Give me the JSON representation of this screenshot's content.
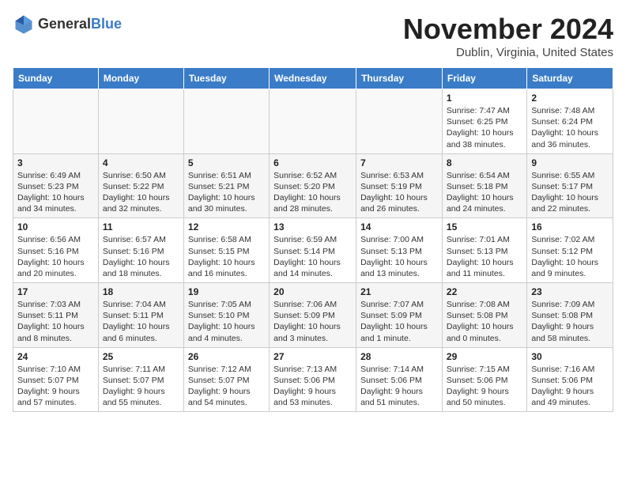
{
  "header": {
    "logo_general": "General",
    "logo_blue": "Blue",
    "month": "November 2024",
    "location": "Dublin, Virginia, United States"
  },
  "weekdays": [
    "Sunday",
    "Monday",
    "Tuesday",
    "Wednesday",
    "Thursday",
    "Friday",
    "Saturday"
  ],
  "weeks": [
    [
      {
        "day": "",
        "info": ""
      },
      {
        "day": "",
        "info": ""
      },
      {
        "day": "",
        "info": ""
      },
      {
        "day": "",
        "info": ""
      },
      {
        "day": "",
        "info": ""
      },
      {
        "day": "1",
        "info": "Sunrise: 7:47 AM\nSunset: 6:25 PM\nDaylight: 10 hours and 38 minutes."
      },
      {
        "day": "2",
        "info": "Sunrise: 7:48 AM\nSunset: 6:24 PM\nDaylight: 10 hours and 36 minutes."
      }
    ],
    [
      {
        "day": "3",
        "info": "Sunrise: 6:49 AM\nSunset: 5:23 PM\nDaylight: 10 hours and 34 minutes."
      },
      {
        "day": "4",
        "info": "Sunrise: 6:50 AM\nSunset: 5:22 PM\nDaylight: 10 hours and 32 minutes."
      },
      {
        "day": "5",
        "info": "Sunrise: 6:51 AM\nSunset: 5:21 PM\nDaylight: 10 hours and 30 minutes."
      },
      {
        "day": "6",
        "info": "Sunrise: 6:52 AM\nSunset: 5:20 PM\nDaylight: 10 hours and 28 minutes."
      },
      {
        "day": "7",
        "info": "Sunrise: 6:53 AM\nSunset: 5:19 PM\nDaylight: 10 hours and 26 minutes."
      },
      {
        "day": "8",
        "info": "Sunrise: 6:54 AM\nSunset: 5:18 PM\nDaylight: 10 hours and 24 minutes."
      },
      {
        "day": "9",
        "info": "Sunrise: 6:55 AM\nSunset: 5:17 PM\nDaylight: 10 hours and 22 minutes."
      }
    ],
    [
      {
        "day": "10",
        "info": "Sunrise: 6:56 AM\nSunset: 5:16 PM\nDaylight: 10 hours and 20 minutes."
      },
      {
        "day": "11",
        "info": "Sunrise: 6:57 AM\nSunset: 5:16 PM\nDaylight: 10 hours and 18 minutes."
      },
      {
        "day": "12",
        "info": "Sunrise: 6:58 AM\nSunset: 5:15 PM\nDaylight: 10 hours and 16 minutes."
      },
      {
        "day": "13",
        "info": "Sunrise: 6:59 AM\nSunset: 5:14 PM\nDaylight: 10 hours and 14 minutes."
      },
      {
        "day": "14",
        "info": "Sunrise: 7:00 AM\nSunset: 5:13 PM\nDaylight: 10 hours and 13 minutes."
      },
      {
        "day": "15",
        "info": "Sunrise: 7:01 AM\nSunset: 5:13 PM\nDaylight: 10 hours and 11 minutes."
      },
      {
        "day": "16",
        "info": "Sunrise: 7:02 AM\nSunset: 5:12 PM\nDaylight: 10 hours and 9 minutes."
      }
    ],
    [
      {
        "day": "17",
        "info": "Sunrise: 7:03 AM\nSunset: 5:11 PM\nDaylight: 10 hours and 8 minutes."
      },
      {
        "day": "18",
        "info": "Sunrise: 7:04 AM\nSunset: 5:11 PM\nDaylight: 10 hours and 6 minutes."
      },
      {
        "day": "19",
        "info": "Sunrise: 7:05 AM\nSunset: 5:10 PM\nDaylight: 10 hours and 4 minutes."
      },
      {
        "day": "20",
        "info": "Sunrise: 7:06 AM\nSunset: 5:09 PM\nDaylight: 10 hours and 3 minutes."
      },
      {
        "day": "21",
        "info": "Sunrise: 7:07 AM\nSunset: 5:09 PM\nDaylight: 10 hours and 1 minute."
      },
      {
        "day": "22",
        "info": "Sunrise: 7:08 AM\nSunset: 5:08 PM\nDaylight: 10 hours and 0 minutes."
      },
      {
        "day": "23",
        "info": "Sunrise: 7:09 AM\nSunset: 5:08 PM\nDaylight: 9 hours and 58 minutes."
      }
    ],
    [
      {
        "day": "24",
        "info": "Sunrise: 7:10 AM\nSunset: 5:07 PM\nDaylight: 9 hours and 57 minutes."
      },
      {
        "day": "25",
        "info": "Sunrise: 7:11 AM\nSunset: 5:07 PM\nDaylight: 9 hours and 55 minutes."
      },
      {
        "day": "26",
        "info": "Sunrise: 7:12 AM\nSunset: 5:07 PM\nDaylight: 9 hours and 54 minutes."
      },
      {
        "day": "27",
        "info": "Sunrise: 7:13 AM\nSunset: 5:06 PM\nDaylight: 9 hours and 53 minutes."
      },
      {
        "day": "28",
        "info": "Sunrise: 7:14 AM\nSunset: 5:06 PM\nDaylight: 9 hours and 51 minutes."
      },
      {
        "day": "29",
        "info": "Sunrise: 7:15 AM\nSunset: 5:06 PM\nDaylight: 9 hours and 50 minutes."
      },
      {
        "day": "30",
        "info": "Sunrise: 7:16 AM\nSunset: 5:06 PM\nDaylight: 9 hours and 49 minutes."
      }
    ]
  ]
}
